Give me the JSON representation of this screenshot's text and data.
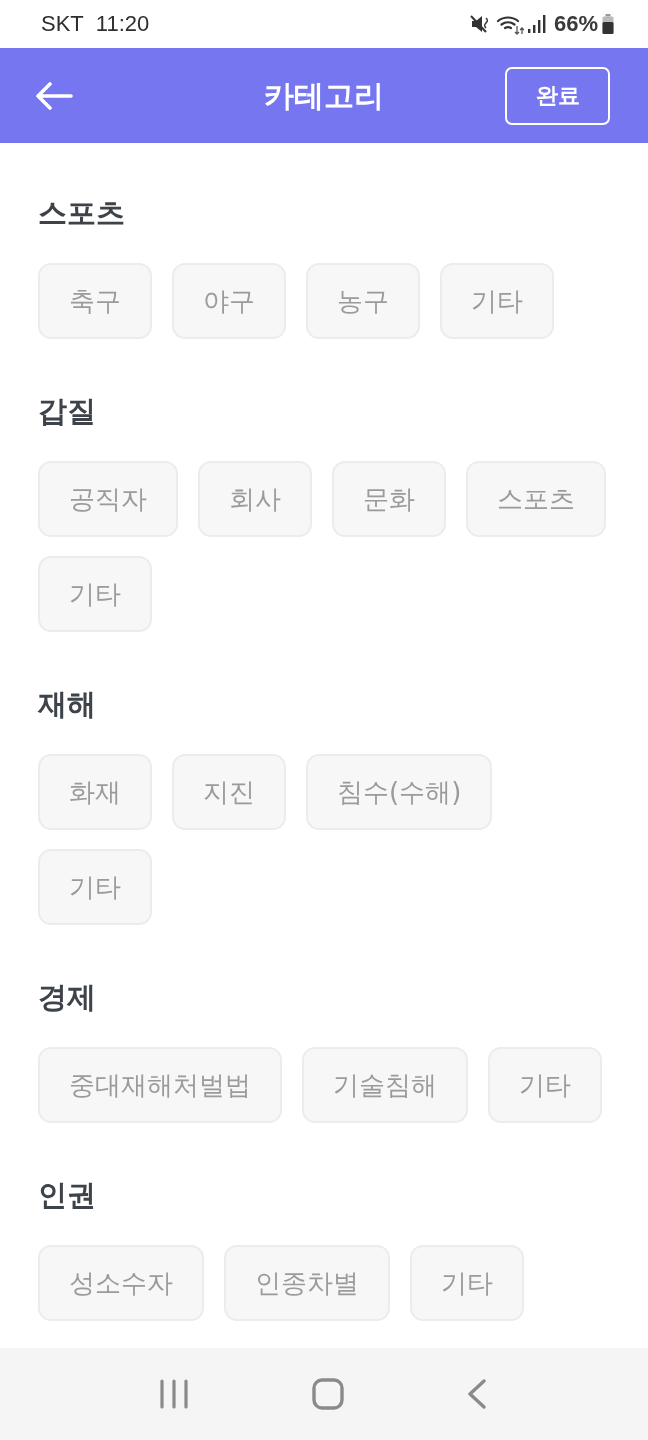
{
  "status_bar": {
    "carrier": "SKT",
    "time": "11:20",
    "battery": "66%"
  },
  "header": {
    "title": "카테고리",
    "done_button": "완료"
  },
  "sections": [
    {
      "title": "스포츠",
      "chips": [
        {
          "label": "축구",
          "selected": false
        },
        {
          "label": "야구",
          "selected": false
        },
        {
          "label": "농구",
          "selected": false
        },
        {
          "label": "기타",
          "selected": false
        }
      ]
    },
    {
      "title": "갑질",
      "chips": [
        {
          "label": "공직자",
          "selected": false
        },
        {
          "label": "회사",
          "selected": false
        },
        {
          "label": "문화",
          "selected": false
        },
        {
          "label": "스포츠",
          "selected": false
        },
        {
          "label": "기타",
          "selected": false
        }
      ]
    },
    {
      "title": "재해",
      "chips": [
        {
          "label": "화재",
          "selected": false
        },
        {
          "label": "지진",
          "selected": false
        },
        {
          "label": "침수(수해)",
          "selected": false
        },
        {
          "label": "기타",
          "selected": false
        }
      ]
    },
    {
      "title": "경제",
      "chips": [
        {
          "label": "중대재해처벌법",
          "selected": false
        },
        {
          "label": "기술침해",
          "selected": false
        },
        {
          "label": "기타",
          "selected": false
        }
      ]
    },
    {
      "title": "인권",
      "chips": [
        {
          "label": "성소수자",
          "selected": false
        },
        {
          "label": "인종차별",
          "selected": false
        },
        {
          "label": "기타",
          "selected": false
        }
      ]
    }
  ]
}
